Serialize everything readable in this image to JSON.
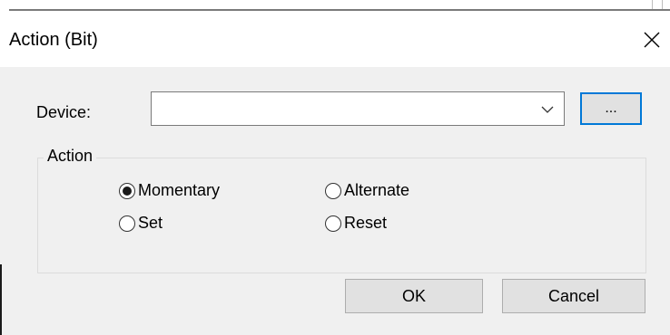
{
  "dialog": {
    "title": "Action (Bit)",
    "close_icon": "close-icon"
  },
  "device": {
    "label": "Device:",
    "value": "",
    "dropdown_icon": "chevron-down-icon",
    "browse_label": "..."
  },
  "action_group": {
    "label": "Action",
    "options": [
      {
        "label": "Momentary",
        "checked": true
      },
      {
        "label": "Alternate",
        "checked": false
      },
      {
        "label": "Set",
        "checked": false
      },
      {
        "label": "Reset",
        "checked": false
      }
    ]
  },
  "buttons": {
    "ok_label": "OK",
    "cancel_label": "Cancel"
  },
  "colors": {
    "dialog_background": "#f0f0f0",
    "focus_border": "#0078d7",
    "button_face": "#e1e1e1"
  }
}
